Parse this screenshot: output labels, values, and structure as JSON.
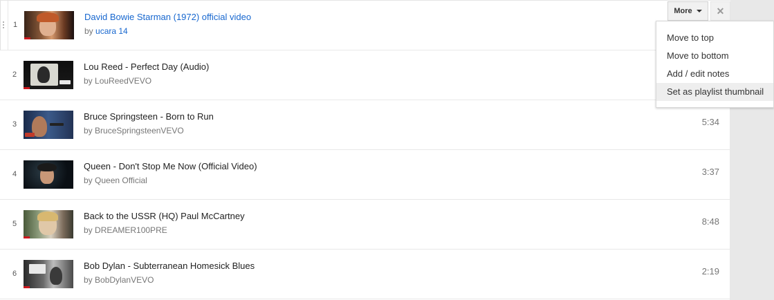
{
  "playlist": {
    "items": [
      {
        "index": "1",
        "title": "David Bowie Starman (1972) official video",
        "by": "by",
        "channel": "ucara 14",
        "duration": "",
        "progress": 0.12
      },
      {
        "index": "2",
        "title": "Lou Reed - Perfect Day (Audio)",
        "by": "by",
        "channel": "LouReedVEVO",
        "duration": "",
        "progress": 0.12
      },
      {
        "index": "3",
        "title": "Bruce Springsteen - Born to Run",
        "by": "by",
        "channel": "BruceSpringsteenVEVO",
        "duration": "5:34",
        "progress": 0
      },
      {
        "index": "4",
        "title": "Queen - Don't Stop Me Now (Official Video)",
        "by": "by",
        "channel": "Queen Official",
        "duration": "3:37",
        "progress": 0
      },
      {
        "index": "5",
        "title": "Back to the USSR (HQ) Paul McCartney",
        "by": "by",
        "channel": "DREAMER100PRE",
        "duration": "8:48",
        "progress": 0.12
      },
      {
        "index": "6",
        "title": "Bob Dylan - Subterranean Homesick Blues",
        "by": "by",
        "channel": "BobDylanVEVO",
        "duration": "2:19",
        "progress": 0.12
      }
    ]
  },
  "row_actions": {
    "more_label": "More",
    "close_glyph": "✕"
  },
  "more_menu": {
    "items": [
      {
        "label": "Move to top"
      },
      {
        "label": "Move to bottom"
      },
      {
        "label": "Add / edit notes"
      },
      {
        "label": "Set as playlist thumbnail"
      }
    ]
  },
  "colors": {
    "active_title": "#1767cf",
    "progress": "#cc181e",
    "gutter": "#e8e8e8"
  },
  "icons": {
    "drag_handle": "drag-handle-icon",
    "caret": "caret-down-icon",
    "close": "close-icon"
  }
}
